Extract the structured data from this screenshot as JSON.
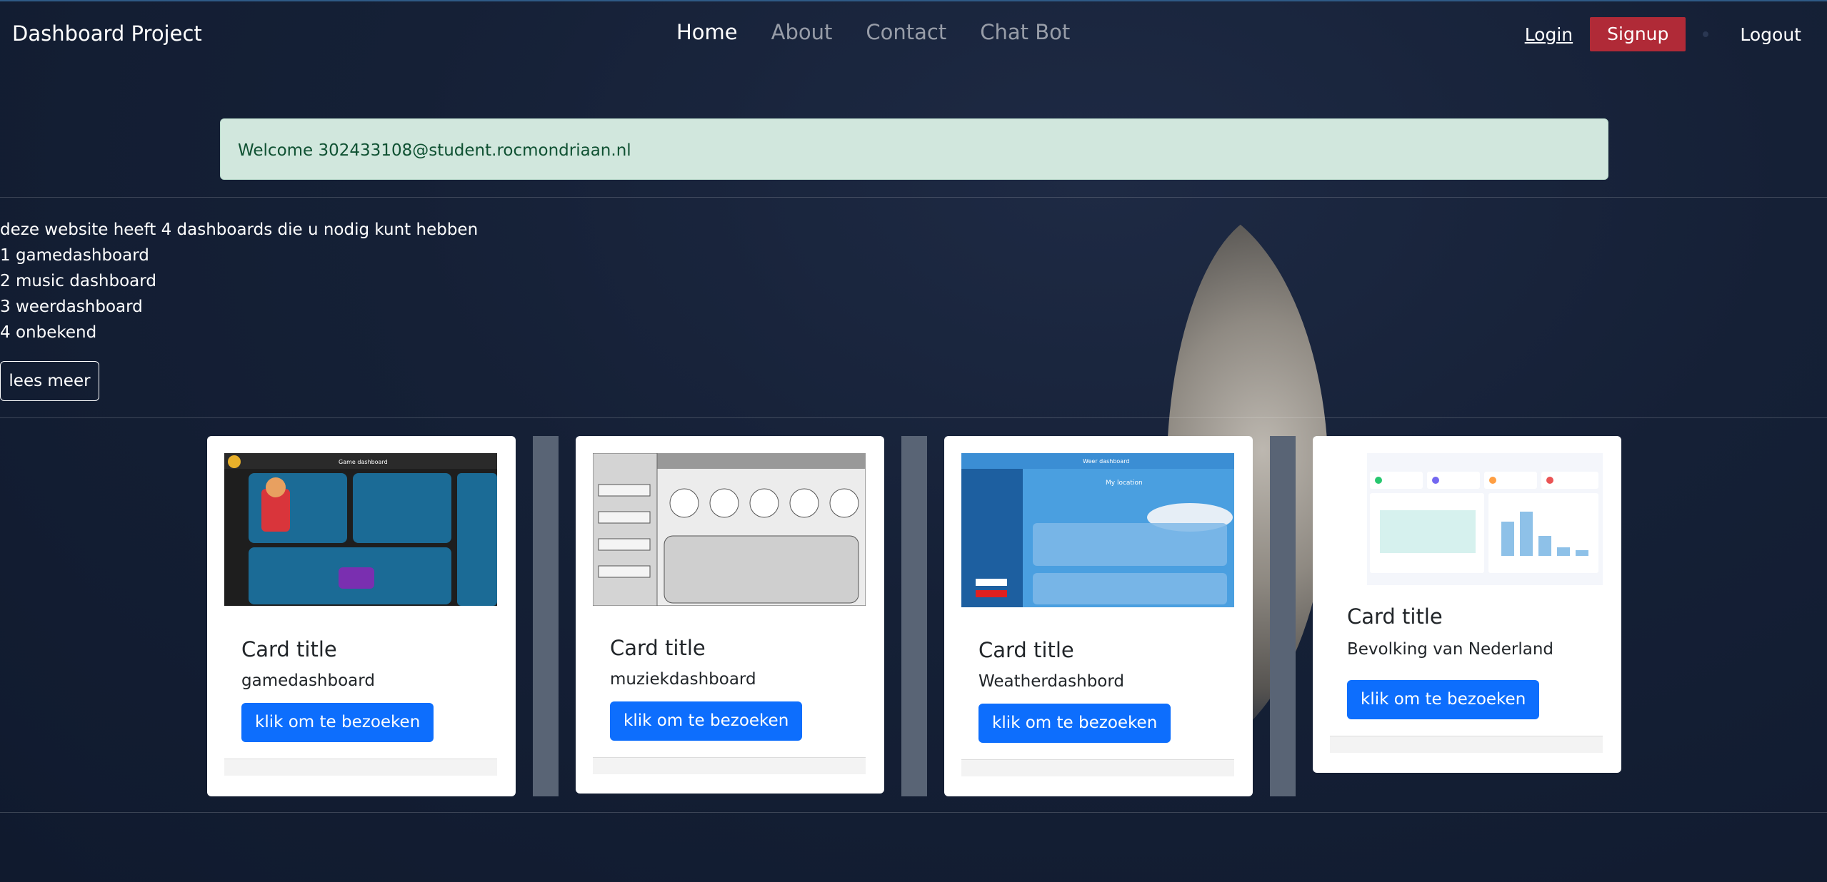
{
  "navbar": {
    "brand": "Dashboard Project",
    "links": [
      {
        "label": "Home",
        "active": true
      },
      {
        "label": "About",
        "active": false
      },
      {
        "label": "Contact",
        "active": false
      },
      {
        "label": "Chat Bot",
        "active": false
      }
    ],
    "login_label": "Login",
    "signup_label": "Signup",
    "logout_label": "Logout"
  },
  "alert": {
    "message": "Welcome 302433108@student.rocmondriaan.nl"
  },
  "intro": {
    "lines": [
      "deze website heeft 4 dashboards die u nodig kunt hebben",
      "1 gamedashboard",
      "2 music dashboard",
      "3 weerdashboard",
      "4 onbekend"
    ],
    "button_label": "lees meer"
  },
  "cards": [
    {
      "title": "Card title",
      "text": "gamedashboard",
      "button_label": "klik om te bezoeken",
      "thumb_title": "Game dashboard"
    },
    {
      "title": "Card title",
      "text": "muziekdashboard",
      "button_label": "klik om te bezoeken"
    },
    {
      "title": "Card title",
      "text": "Weatherdashbord",
      "button_label": "klik om te bezoeken",
      "thumb_title": "Weer dashboard",
      "thumb_location": "My location"
    },
    {
      "title": "Card title",
      "text": "Bevolking van Nederland",
      "button_label": "klik om te bezoeken"
    }
  ],
  "colors": {
    "primary": "#0d6efd",
    "danger": "#b02a37",
    "alert_bg": "#d1e7dd",
    "alert_text": "#0f5132"
  }
}
